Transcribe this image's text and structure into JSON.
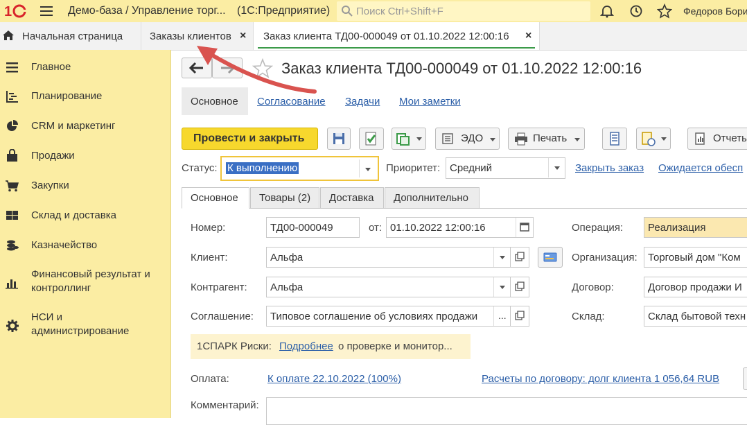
{
  "topbar": {
    "app_title": "Демо-база / Управление торг...",
    "platform": "(1С:Предприятие)",
    "search_placeholder": "Поиск Ctrl+Shift+F",
    "user": "Федоров Борис"
  },
  "tabs": [
    {
      "label": "Начальная страница"
    },
    {
      "label": "Заказы клиентов"
    },
    {
      "label": "Заказ клиента ТД00-000049 от 01.10.2022 12:00:16"
    }
  ],
  "sidebar": {
    "items": [
      {
        "label": "Главное",
        "icon": "menu-icon"
      },
      {
        "label": "Планирование",
        "icon": "planning-icon"
      },
      {
        "label": "CRM и маркетинг",
        "icon": "pie-chart-icon"
      },
      {
        "label": "Продажи",
        "icon": "bag-icon"
      },
      {
        "label": "Закупки",
        "icon": "cart-icon"
      },
      {
        "label": "Склад и доставка",
        "icon": "warehouse-icon"
      },
      {
        "label": "Казначейство",
        "icon": "coins-icon"
      },
      {
        "label": "Финансовый результат и",
        "label2": "контроллинг",
        "icon": "bar-chart-icon"
      },
      {
        "label": "НСИ и",
        "label2": "администрирование",
        "icon": "gear-icon"
      }
    ]
  },
  "doc": {
    "title": "Заказ клиента ТД00-000049 от 01.10.2022 12:00:16",
    "subtabs": [
      "Основное",
      "Согласование",
      "Задачи",
      "Мои заметки"
    ]
  },
  "toolbar": {
    "post_close": "Провести и закрыть",
    "edo": "ЭДО",
    "print": "Печать",
    "reports": "Отчеты"
  },
  "status_row": {
    "status_label": "Статус:",
    "status_value": "К выполнению",
    "priority_label": "Приоритет:",
    "priority_value": "Средний",
    "close_order": "Закрыть заказ",
    "waiting": "Ожидается обесп"
  },
  "form_tabs": [
    "Основное",
    "Товары (2)",
    "Доставка",
    "Дополнительно"
  ],
  "form": {
    "number_label": "Номер:",
    "number_value": "ТД00-000049",
    "from_label": "от:",
    "date_value": "01.10.2022 12:00:16",
    "client_label": "Клиент:",
    "client_value": "Альфа",
    "counterparty_label": "Контрагент:",
    "counterparty_value": "Альфа",
    "agreement_label": "Соглашение:",
    "agreement_value": "Типовое соглашение об условиях продажи",
    "operation_label": "Операция:",
    "operation_value": "Реализация",
    "org_label": "Организация:",
    "org_value": "Торговый дом \"Ком",
    "contract_label": "Договор:",
    "contract_value": "Договор продажи И",
    "warehouse_label": "Склад:",
    "warehouse_value": "Склад бытовой техн",
    "spark_prefix": "1СПАРК Риски:",
    "spark_link": "Подробнее",
    "spark_suffix": "о проверке и монитор...",
    "payment_label": "Оплата:",
    "payment_link": "К оплате 22.10.2022 (100%)",
    "settlements_link": "Расчеты по договору: долг клиента 1 056,64 RUB",
    "comment_label": "Комментарий:",
    "ellipsis": "..."
  },
  "colors": {
    "accent_yellow": "#fbeda3",
    "link": "#2c5fa8",
    "arrow": "#d9534f",
    "active_tab_line": "#3c9b49"
  }
}
